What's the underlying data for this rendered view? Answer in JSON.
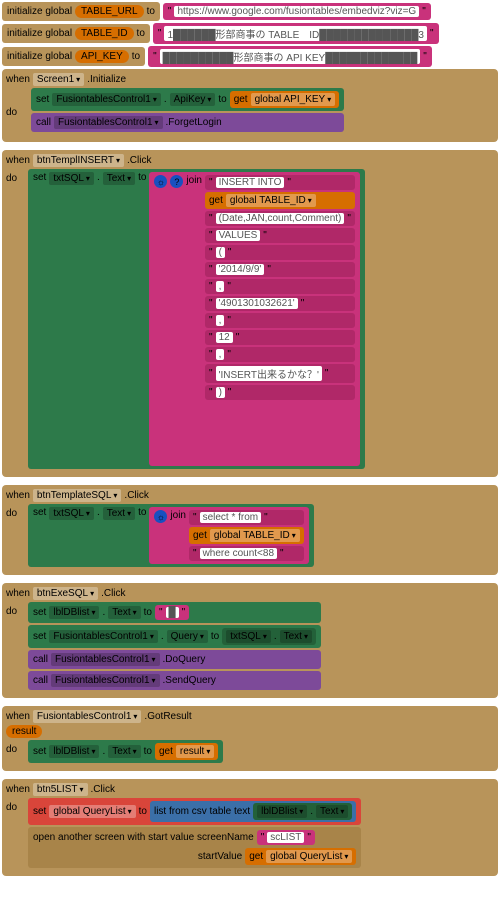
{
  "globals": [
    {
      "keyword": "initialize global",
      "name": "TABLE_URL",
      "to": "to",
      "value": "https://www.google.com/fusiontables/embedviz?viz=G"
    },
    {
      "keyword": "initialize global",
      "name": "TABLE_ID",
      "to": "to",
      "value": "1██████形部商事の TABLE　ID██████████████3"
    },
    {
      "keyword": "initialize global",
      "name": "API_KEY",
      "to": "to",
      "value": "██████████形部商事の API KEY█████████████"
    }
  ],
  "screen1": {
    "when": "when",
    "obj": "Screen1",
    "evt": ".Initialize",
    "do": "do",
    "set": "set",
    "comp": "FusiontablesControl1",
    "prop": "ApiKey",
    "to": "to",
    "get": "get",
    "gv": "global API_KEY",
    "call": "call",
    "method": ".ForgetLogin"
  },
  "templInsert": {
    "when": "when",
    "obj": "btnTemplINSERT",
    "evt": ".Click",
    "do": "do",
    "set": "set",
    "target": "txtSQL",
    "prop": "Text",
    "to": "to",
    "join": "join",
    "items": [
      {
        "t": "str",
        "v": "INSERT INTO "
      },
      {
        "t": "get",
        "v": "global TABLE_ID"
      },
      {
        "t": "str",
        "v": "(Date,JAN,count,Comment)"
      },
      {
        "t": "str",
        "v": "VALUES "
      },
      {
        "t": "str",
        "v": "( "
      },
      {
        "t": "str",
        "v": "'2014/9/9'"
      },
      {
        "t": "str",
        "v": ", "
      },
      {
        "t": "str",
        "v": "'4901301032621'"
      },
      {
        "t": "str",
        "v": ", "
      },
      {
        "t": "str",
        "v": "12"
      },
      {
        "t": "str",
        "v": ", "
      },
      {
        "t": "str",
        "v": "'INSERT出来るかな？'"
      },
      {
        "t": "str",
        "v": ") "
      }
    ]
  },
  "templSQL": {
    "when": "when",
    "obj": "btnTemplateSQL",
    "evt": ".Click",
    "do": "do",
    "set": "set",
    "target": "txtSQL",
    "prop": "Text",
    "to": "to",
    "join": "join",
    "items": [
      {
        "t": "str",
        "v": "select * from "
      },
      {
        "t": "get",
        "v": "global TABLE_ID"
      },
      {
        "t": "str",
        "v": " where count<88 "
      }
    ]
  },
  "exeSQL": {
    "when": "when",
    "obj": "btnExeSQL",
    "evt": ".Click",
    "do": "do",
    "rows": [
      {
        "set": "set",
        "target": "lblDBlist",
        "prop": "Text",
        "to": "to",
        "val": "█"
      },
      {
        "set": "set",
        "target": "FusiontablesControl1",
        "prop": "Query",
        "to": "to",
        "srcTarget": "txtSQL",
        "srcProp": "Text"
      },
      {
        "call": "call",
        "target": "FusiontablesControl1",
        "method": ".DoQuery"
      },
      {
        "call": "call",
        "target": "FusiontablesControl1",
        "method": ".SendQuery"
      }
    ]
  },
  "gotResult": {
    "when": "when",
    "obj": "FusiontablesControl1",
    "evt": ".GotResult",
    "param": "result",
    "do": "do",
    "set": "set",
    "target": "lblDBlist",
    "prop": "Text",
    "to": "to",
    "get": "get",
    "gv": "result"
  },
  "btn5": {
    "when": "when",
    "obj": "btn5LIST",
    "evt": ".Click",
    "do": "do",
    "set": "set",
    "gv": "global QueryList",
    "to": "to",
    "list": "list from csv table  text",
    "srcTarget": "lblDBlist",
    "srcProp": "Text",
    "open": "open another screen with start value  screenName",
    "screen": "scLIST",
    "startLabel": "startValue",
    "get": "get",
    "startGv": "global QueryList"
  },
  "labels": {
    "dot": ". ",
    "quote": "\" ",
    "quoteR": " \"",
    "gear": "☼",
    "q": "?"
  }
}
